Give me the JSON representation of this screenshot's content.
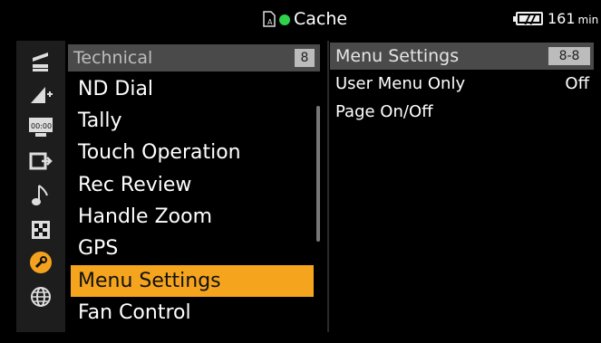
{
  "status_bar": {
    "media_label": "Cache",
    "battery_value": "161",
    "battery_unit": "min",
    "recording_indicator_color": "#2fd24a",
    "card_icon": "memory-card-icon",
    "battery_icon": "battery-icon"
  },
  "rail": {
    "icons": [
      "camera-icon",
      "paint-icon",
      "timecode-icon",
      "tc-output-icon",
      "audio-icon",
      "video-icon",
      "wrench-icon",
      "network-icon"
    ],
    "active_color": "#f4a21e"
  },
  "menu": {
    "header": "Technical",
    "page": "8",
    "items": [
      {
        "label": "ND Dial",
        "selected": false
      },
      {
        "label": "Tally",
        "selected": false
      },
      {
        "label": "Touch Operation",
        "selected": false
      },
      {
        "label": "Rec Review",
        "selected": false
      },
      {
        "label": "Handle Zoom",
        "selected": false
      },
      {
        "label": "GPS",
        "selected": false
      },
      {
        "label": "Menu Settings",
        "selected": true
      },
      {
        "label": "Fan Control",
        "selected": false
      }
    ],
    "selected_color": "#f5a41d"
  },
  "detail": {
    "header": "Menu Settings",
    "page": "8-8",
    "rows": [
      {
        "label": "User Menu Only",
        "value": "Off"
      },
      {
        "label": "Page On/Off",
        "value": ""
      }
    ]
  }
}
